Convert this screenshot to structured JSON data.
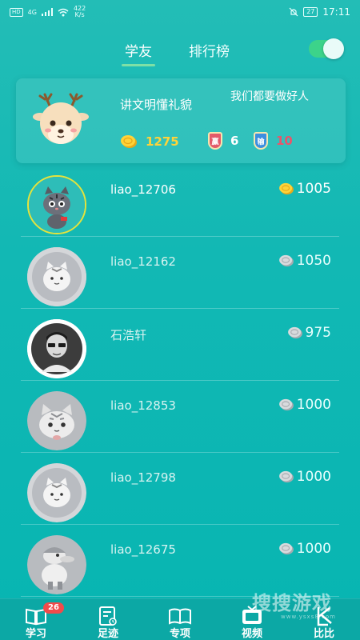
{
  "status_bar": {
    "hd": "HD",
    "network": "4G",
    "speed_value": "422",
    "speed_unit": "K/s",
    "battery": "27",
    "time": "17:11"
  },
  "header": {
    "tabs": [
      {
        "label": "学友",
        "active": true
      },
      {
        "label": "排行榜",
        "active": false
      }
    ],
    "toggle_on": true
  },
  "my_card": {
    "name": "讲文明懂礼貌",
    "motto": "我们都要做好人",
    "coins": "1275",
    "win_badge": "赢",
    "wins": "6",
    "lose_badge": "输",
    "losses": "10"
  },
  "friends": [
    {
      "name": "liao_12706",
      "coins": "1005",
      "coin_color": "gold"
    },
    {
      "name": "liao_12162",
      "coins": "1050",
      "coin_color": "silver"
    },
    {
      "name": "石浩轩",
      "coins": "975",
      "coin_color": "silver"
    },
    {
      "name": "liao_12853",
      "coins": "1000",
      "coin_color": "silver"
    },
    {
      "name": "liao_12798",
      "coins": "1000",
      "coin_color": "silver"
    },
    {
      "name": "liao_12675",
      "coins": "1000",
      "coin_color": "silver"
    }
  ],
  "bottom_nav": [
    {
      "label": "学习",
      "icon": "book-icon",
      "badge": "26"
    },
    {
      "label": "足迹",
      "icon": "footprint-icon"
    },
    {
      "label": "专项",
      "icon": "open-book-icon"
    },
    {
      "label": "视频",
      "icon": "tv-icon"
    },
    {
      "label": "比比",
      "icon": "compare-icon"
    }
  ],
  "watermark": {
    "main": "搜搜游戏",
    "sub": "www.ysxs8.com"
  },
  "colors": {
    "background": "#12b8b4",
    "accent_green": "#3cd38a",
    "gold": "#ffd338",
    "loss_red": "#e9556a"
  }
}
